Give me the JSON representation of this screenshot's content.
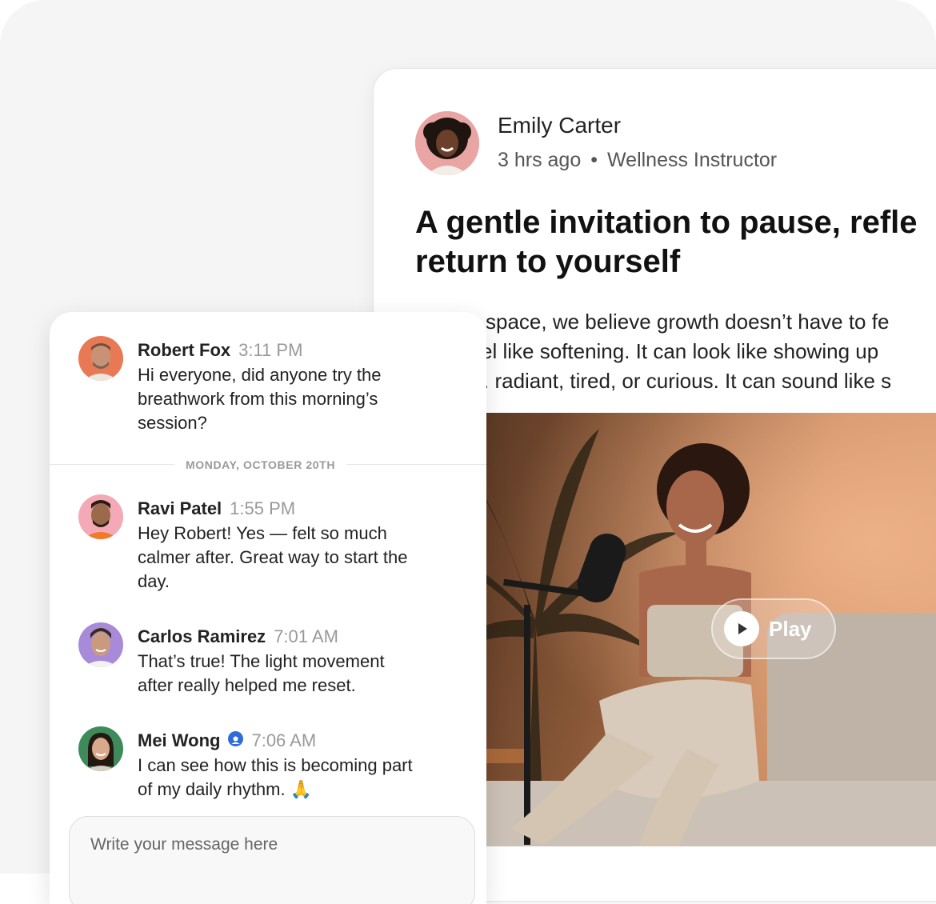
{
  "post": {
    "author": {
      "name": "Emily Carter",
      "time": "3 hrs ago",
      "separator": "•",
      "role": "Wellness Instructor"
    },
    "title_lines": [
      "A gentle invitation to pause, refle",
      "return to yourself"
    ],
    "body_lines": [
      "space, we believe growth doesn’t have to fe",
      "el like softening. It can look like showing up",
      ". radiant, tired, or curious. It can sound like s"
    ],
    "video": {
      "play_label": "Play"
    }
  },
  "chat": {
    "messages": [
      {
        "name": "Robert Fox",
        "time": "3:11 PM",
        "lines": [
          "Hi everyone, did anyone try the",
          "breathwork from this morning’s",
          "session?"
        ],
        "avatar_color": "#e77a54"
      },
      {
        "name": "Ravi Patel",
        "time": "1:55 PM",
        "lines": [
          "Hey Robert! Yes — felt so much",
          "calmer after. Great way to start the",
          "day."
        ],
        "avatar_color": "#f4a9b6"
      },
      {
        "name": "Carlos Ramirez",
        "time": "7:01 AM",
        "lines": [
          "That’s true! The light movement",
          "after really helped me reset."
        ],
        "avatar_color": "#a78bd8"
      },
      {
        "name": "Mei Wong",
        "time": "7:06 AM",
        "lines": [
          "I can see how this is becoming part",
          "of my daily rhythm. 🙏"
        ],
        "avatar_color": "#3f8a5a",
        "verified": true
      }
    ],
    "date_divider": "MONDAY, OCTOBER 20TH",
    "composer": {
      "placeholder": "Write your message here"
    }
  }
}
